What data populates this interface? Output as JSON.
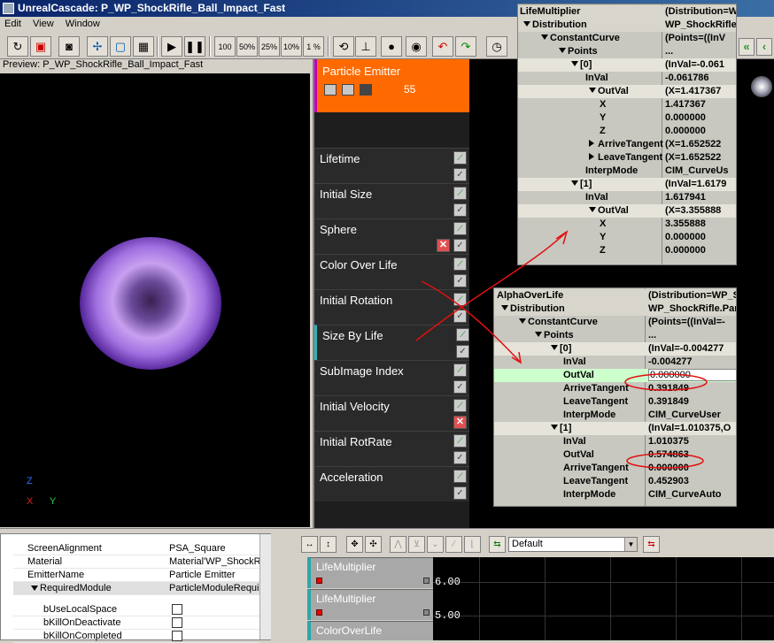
{
  "window": {
    "title": "UnrealCascade: P_WP_ShockRifle_Ball_Impact_Fast"
  },
  "menu": [
    "Edit",
    "View",
    "Window"
  ],
  "toolbar": {
    "pct100": "100",
    "pct50": "50%",
    "pct25": "25%",
    "pct10": "10%",
    "pct1": "1 %"
  },
  "preview": {
    "label": "Preview: P_WP_ShockRifle_Ball_Impact_Fast",
    "axis_z": "Z",
    "axis_x": "X",
    "axis_y": "Y"
  },
  "emitter": {
    "title": "Particle Emitter",
    "count": "55",
    "modules": [
      {
        "name": "Lifetime"
      },
      {
        "name": "Initial Size"
      },
      {
        "name": "Sphere"
      },
      {
        "name": "Color Over Life"
      },
      {
        "name": "Initial Rotation"
      },
      {
        "name": "Size By Life"
      },
      {
        "name": "SubImage Index"
      },
      {
        "name": "Initial Velocity"
      },
      {
        "name": "Initial RotRate"
      },
      {
        "name": "Acceleration"
      }
    ]
  },
  "life_panel": {
    "rows": [
      {
        "k": "LifeMultiplier",
        "v": "(Distribution=W"
      },
      {
        "k": "Distribution",
        "v": "WP_ShockRifle"
      },
      {
        "k": "ConstantCurve",
        "v": "(Points=((InV"
      },
      {
        "k": "Points",
        "v": "..."
      },
      {
        "k": "[0]",
        "v": "(InVal=-0.061"
      },
      {
        "k": "InVal",
        "v": "-0.061786"
      },
      {
        "k": "OutVal",
        "v": "(X=1.417367"
      },
      {
        "k": "X",
        "v": "1.417367"
      },
      {
        "k": "Y",
        "v": "0.000000"
      },
      {
        "k": "Z",
        "v": "0.000000"
      },
      {
        "k": "ArriveTangent",
        "v": "(X=1.652522"
      },
      {
        "k": "LeaveTangent",
        "v": "(X=1.652522"
      },
      {
        "k": "InterpMode",
        "v": "CIM_CurveUs"
      },
      {
        "k": "[1]",
        "v": "(InVal=1.6179"
      },
      {
        "k": "InVal",
        "v": "1.617941"
      },
      {
        "k": "OutVal",
        "v": "(X=3.355888"
      },
      {
        "k": "X",
        "v": "3.355888"
      },
      {
        "k": "Y",
        "v": "0.000000"
      },
      {
        "k": "Z",
        "v": "0.000000"
      }
    ]
  },
  "alpha_panel": {
    "rows": [
      {
        "k": "AlphaOverLife",
        "v": "(Distribution=WP_S"
      },
      {
        "k": "Distribution",
        "v": "WP_ShockRifle.Par"
      },
      {
        "k": "ConstantCurve",
        "v": "(Points=((InVal=-"
      },
      {
        "k": "Points",
        "v": "..."
      },
      {
        "k": "[0]",
        "v": "(InVal=-0.004277"
      },
      {
        "k": "InVal",
        "v": "-0.004277"
      },
      {
        "k": "OutVal",
        "v": "0.000000"
      },
      {
        "k": "ArriveTangent",
        "v": "0.391849"
      },
      {
        "k": "LeaveTangent",
        "v": "0.391849"
      },
      {
        "k": "InterpMode",
        "v": "CIM_CurveUser"
      },
      {
        "k": "[1]",
        "v": "(InVal=1.010375,O"
      },
      {
        "k": "InVal",
        "v": "1.010375"
      },
      {
        "k": "OutVal",
        "v": "0.574863"
      },
      {
        "k": "ArriveTangent",
        "v": "0.000000"
      },
      {
        "k": "LeaveTangent",
        "v": "0.452903"
      },
      {
        "k": "InterpMode",
        "v": "CIM_CurveAuto"
      }
    ]
  },
  "bottom_props": {
    "rows": [
      {
        "k": "ScreenAlignment",
        "v": "PSA_Square"
      },
      {
        "k": "Material",
        "v": "Material'WP_ShockRif"
      },
      {
        "k": "EmitterName",
        "v": "Particle Emitter"
      },
      {
        "k": "RequiredModule",
        "v": "ParticleModuleRequir"
      },
      {
        "k": "bUseLocalSpace",
        "v": ""
      },
      {
        "k": "bKillOnDeactivate",
        "v": ""
      },
      {
        "k": "bKillOnCompleted",
        "v": ""
      }
    ]
  },
  "curve_editor": {
    "preset": "Default",
    "tracks": [
      {
        "name": "LifeMultiplier"
      },
      {
        "name": "LifeMultiplier"
      },
      {
        "name": "ColorOverLife"
      }
    ],
    "axis_values": [
      "6.00",
      "5.00"
    ]
  },
  "colors": {
    "emitter_header": "#ff6a00",
    "module_bg": "#2a2a2a",
    "highlight_row": "#ccffcc",
    "annotation_red": "#e01010"
  }
}
